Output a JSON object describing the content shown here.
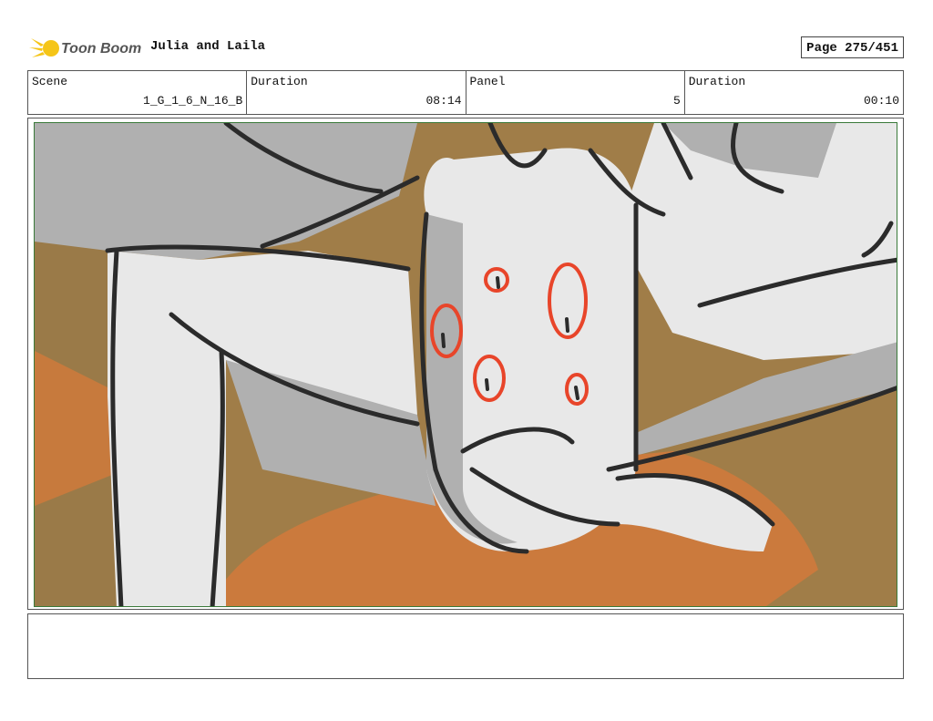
{
  "header": {
    "logo_text": "Toon Boom",
    "project_title": "Julia and Laila",
    "page": "Page 275/451"
  },
  "info": {
    "scene_label": "Scene",
    "scene_value": "1_G_1_6_N_16_B",
    "duration_label": "Duration",
    "duration_value": "08:14",
    "panel_label": "Panel",
    "panel_value": "5",
    "panel_duration_label": "Duration",
    "panel_duration_value": "00:10"
  },
  "notes": {
    "text": ""
  },
  "colors": {
    "logo_yellow": "#f5c518",
    "frame_green": "#3a7a3a",
    "line": "#2b2b2b",
    "skin_gray": "#e8e8e8",
    "shadow_gray": "#b0b0b0",
    "bg_brown": "#a07d48",
    "orange": "#cf7a3c",
    "red_marks": "#e8452a"
  }
}
